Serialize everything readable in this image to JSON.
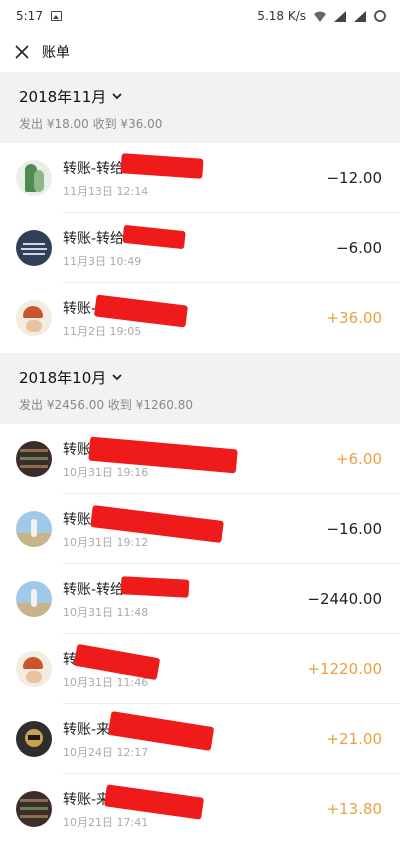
{
  "status": {
    "time": "5:17",
    "speed": "5.18 K/s"
  },
  "header": {
    "title": "账单"
  },
  "months": [
    {
      "label": "2018年11月",
      "summary": "发出 ¥18.00 收到 ¥36.00",
      "items": [
        {
          "name": "转账-转给",
          "date": "11月13日 12:14",
          "amount": "−12.00",
          "positive": false
        },
        {
          "name": "转账-转给",
          "date": "11月3日 10:49",
          "amount": "−6.00",
          "positive": false
        },
        {
          "name": "转账-",
          "date": "11月2日 19:05",
          "amount": "+36.00",
          "positive": true
        }
      ]
    },
    {
      "label": "2018年10月",
      "summary": "发出 ¥2456.00 收到 ¥1260.80",
      "items": [
        {
          "name": "转账-来自",
          "date": "10月31日 19:16",
          "amount": "+6.00",
          "positive": true
        },
        {
          "name": "转账-转给",
          "date": "10月31日 19:12",
          "amount": "−16.00",
          "positive": false
        },
        {
          "name": "转账-转给",
          "date": "10月31日 11:48",
          "amount": "−2440.00",
          "positive": false
        },
        {
          "name": "转账-",
          "date": "10月31日 11:46",
          "amount": "+1220.00",
          "positive": true
        },
        {
          "name": "转账-来自",
          "date": "10月24日 12:17",
          "amount": "+21.00",
          "positive": true
        },
        {
          "name": "转账-来自",
          "date": "10月21日 17:41",
          "amount": "+13.80",
          "positive": true
        }
      ]
    }
  ]
}
